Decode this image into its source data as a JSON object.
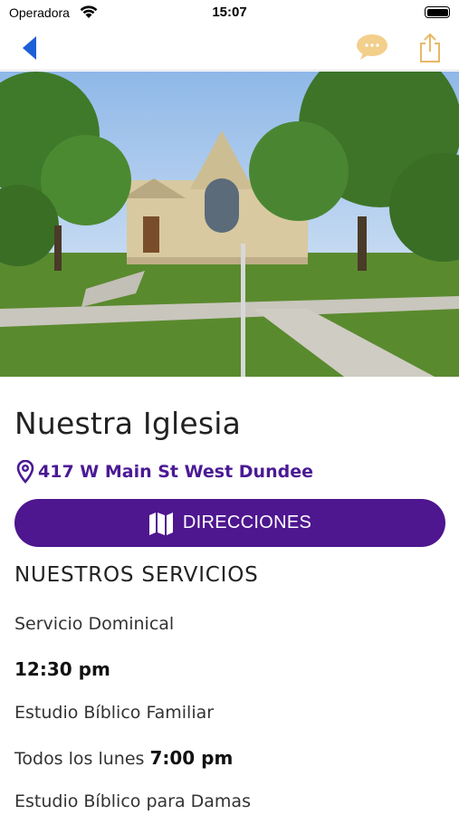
{
  "status_bar": {
    "carrier": "Operadora",
    "time": "15:07"
  },
  "nav": {
    "back_icon": "chevron-left-icon",
    "chat_icon": "chat-bubble-icon",
    "share_icon": "share-icon",
    "accent_color": "#1d5fd6",
    "icon_color": "#f0c070"
  },
  "church": {
    "name": "Nuestra Iglesia",
    "address": "417 W Main St West Dundee",
    "directions_label": "DIRECCIONES"
  },
  "services": {
    "title": "NUESTROS SERVICIOS",
    "items": [
      {
        "text": "Servicio Dominical"
      },
      {
        "time": "12:30 pm"
      },
      {
        "text": "Estudio Bíblico Familiar"
      },
      {
        "text": "Todos los lunes",
        "time": "7:00 pm"
      },
      {
        "text": "Estudio Bíblico para Damas"
      }
    ]
  },
  "colors": {
    "brand": "#4e168f",
    "address": "#4b1a94"
  }
}
